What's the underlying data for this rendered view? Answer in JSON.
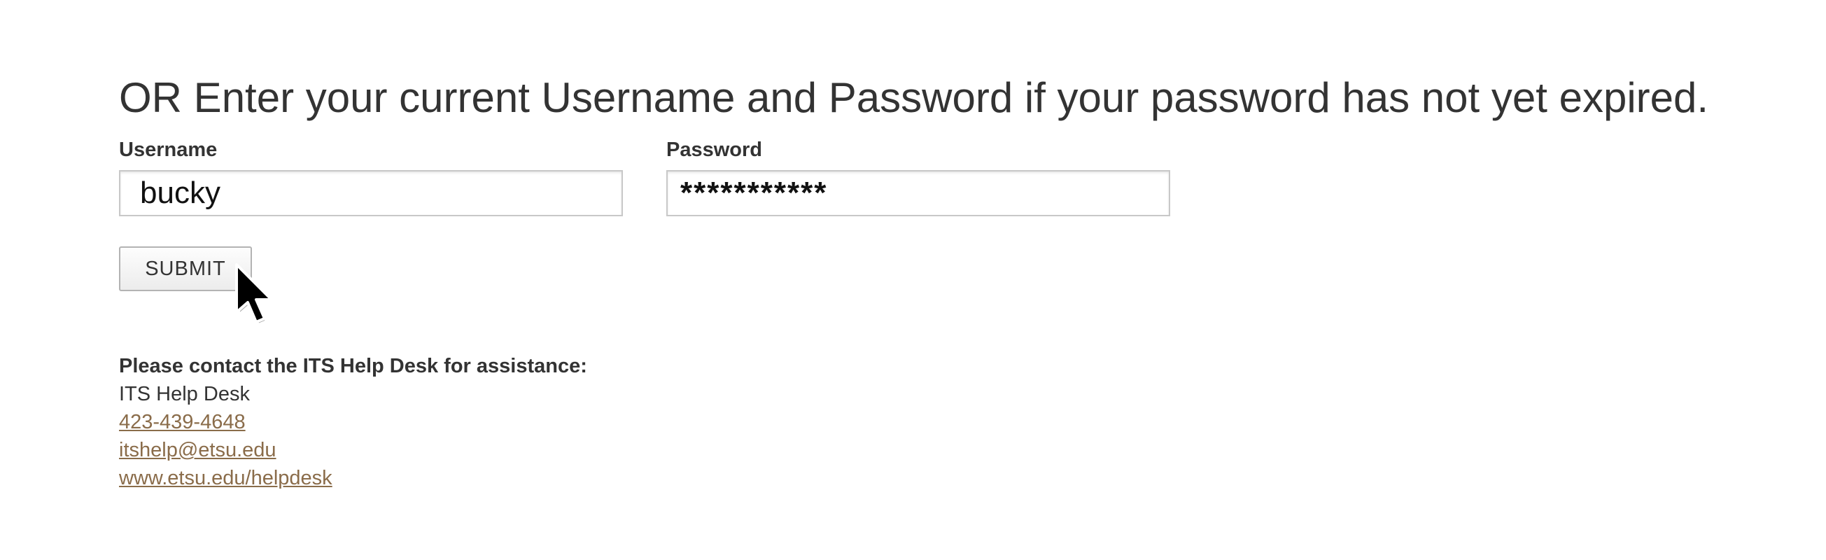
{
  "form": {
    "heading": "OR Enter your current Username and Password if your password has not yet expired.",
    "username": {
      "label": "Username",
      "value": "bucky"
    },
    "password": {
      "label": "Password",
      "value": "***********"
    },
    "submit_label": "SUBMIT"
  },
  "contact": {
    "heading": "Please contact the ITS Help Desk for assistance:",
    "name": "ITS Help Desk",
    "phone": "423-439-4648",
    "email": "itshelp@etsu.edu",
    "website": "www.etsu.edu/helpdesk"
  },
  "colors": {
    "text": "#333333",
    "link": "#8a6c4a",
    "input_border": "#c8c8c8"
  },
  "icons": {
    "cursor": "mouse-pointer-icon"
  }
}
